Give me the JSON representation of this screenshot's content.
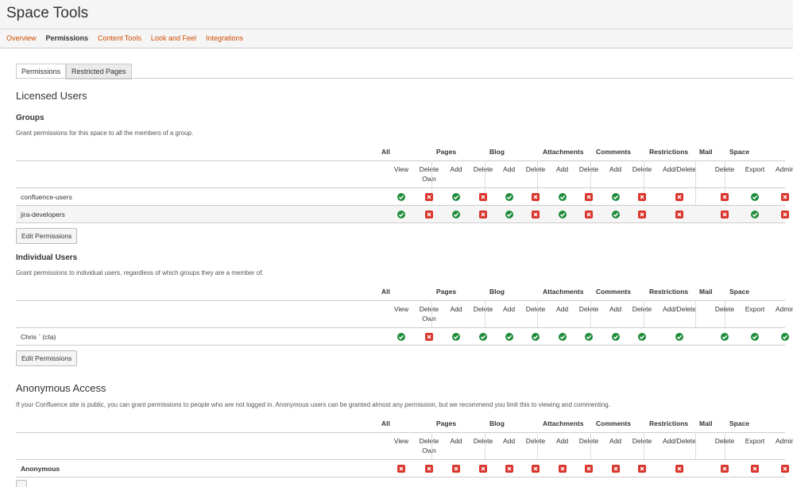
{
  "app": {
    "title": "Space Tools"
  },
  "topnav": [
    {
      "label": "Overview",
      "active": false
    },
    {
      "label": "Permissions",
      "active": true
    },
    {
      "label": "Content Tools",
      "active": false
    },
    {
      "label": "Look and Feel",
      "active": false
    },
    {
      "label": "Integrations",
      "active": false
    }
  ],
  "tabs": [
    {
      "label": "Permissions",
      "active": true
    },
    {
      "label": "Restricted Pages",
      "active": false
    }
  ],
  "licensed": {
    "title": "Licensed Users"
  },
  "groups": {
    "title": "Groups",
    "desc": "Grant permissions for this space to all the members of a group.",
    "rows": [
      {
        "name": "confluence-users",
        "perms": [
          "ok",
          "no",
          "ok",
          "no",
          "ok",
          "no",
          "ok",
          "no",
          "ok",
          "no",
          "no",
          "no",
          "ok",
          "no"
        ]
      },
      {
        "name": "jira-developers",
        "perms": [
          "ok",
          "no",
          "ok",
          "no",
          "ok",
          "no",
          "ok",
          "no",
          "ok",
          "no",
          "no",
          "no",
          "ok",
          "no"
        ]
      }
    ],
    "edit_label": "Edit Permissions"
  },
  "individual": {
    "title": "Individual Users",
    "desc": "Grant permissions to individual users, regardless of which groups they are a member of.",
    "rows": [
      {
        "name": "Chris `         (cta)",
        "perms": [
          "ok",
          "no",
          "ok",
          "ok",
          "ok",
          "ok",
          "ok",
          "ok",
          "ok",
          "ok",
          "ok",
          "ok",
          "ok",
          "ok"
        ]
      }
    ],
    "edit_label": "Edit Permissions"
  },
  "anonymous": {
    "title": "Anonymous Access",
    "desc": "If your Confluence site is public, you can grant permissions to people who are not logged in. Anonymous users can be granted almost any permission, but we recommend you limit this to viewing and commenting.",
    "rows": [
      {
        "name": "Anonymous",
        "perms": [
          "no",
          "no",
          "no",
          "no",
          "no",
          "no",
          "no",
          "no",
          "no",
          "no",
          "no",
          "no",
          "no",
          "no"
        ]
      }
    ]
  },
  "columns": {
    "groups": [
      "All",
      "Pages",
      "Blog",
      "Attachments",
      "Comments",
      "Restrictions",
      "Mail",
      "Space"
    ],
    "headers": [
      "View",
      "Delete\nOwn",
      "Add",
      "Delete",
      "Add",
      "Delete",
      "Add",
      "Delete",
      "Add",
      "Delete",
      "Add/Delete",
      "Delete",
      "Export",
      "Admin"
    ]
  },
  "colors": {
    "ok": "#1e8c3a",
    "no": "#d9342b",
    "link": "#d04a02"
  }
}
